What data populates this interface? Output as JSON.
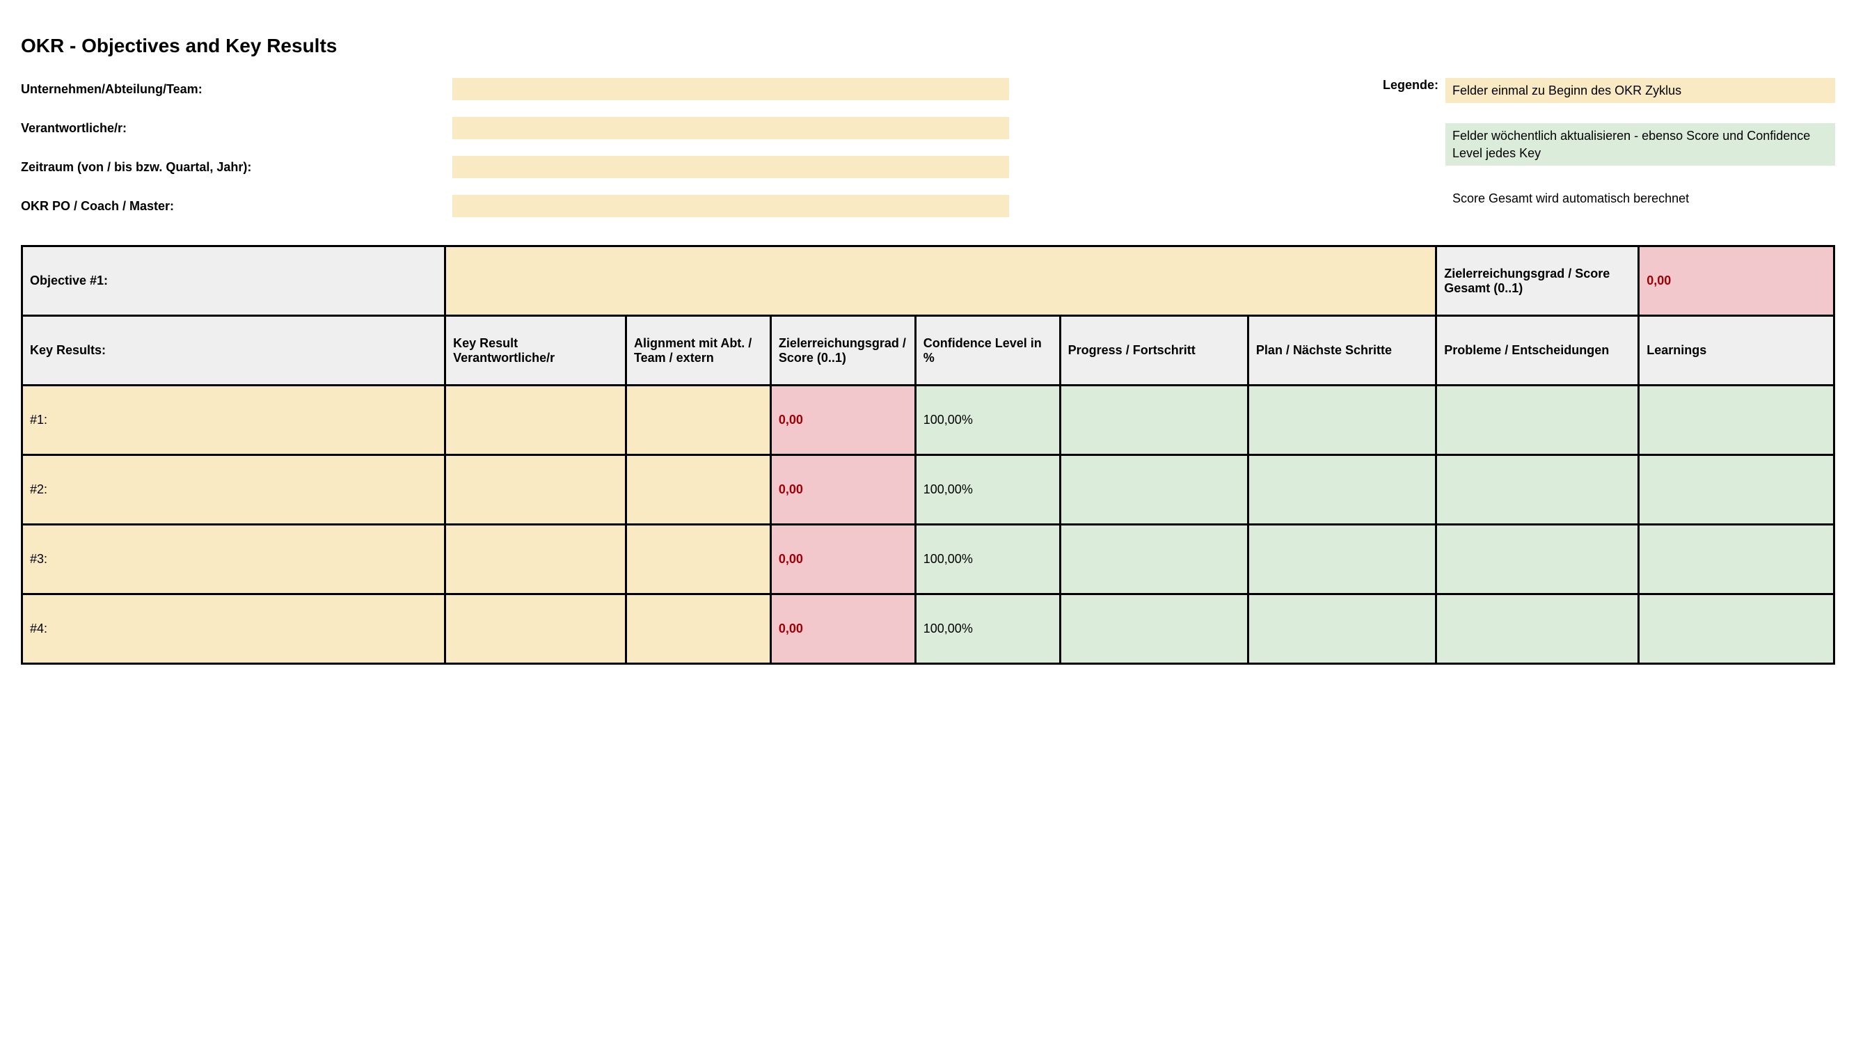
{
  "title": "OKR - Objectives and Key Results",
  "meta": {
    "company_label": "Unternehmen/Abteilung/Team:",
    "responsible_label": "Verantwortliche/r:",
    "period_label": "Zeitraum (von / bis bzw. Quartal, Jahr):",
    "coach_label": "OKR PO / Coach / Master:",
    "company_value": "",
    "responsible_value": "",
    "period_value": "",
    "coach_value": ""
  },
  "legend": {
    "label": "Legende:",
    "item_yellow": "Felder einmal zu Beginn des OKR Zyklus",
    "item_green": "Felder wöchentlich aktualisieren - ebenso Score und Confidence Level jedes Key",
    "item_plain": "Score Gesamt wird automatisch berechnet"
  },
  "table": {
    "objective_label": "Objective #1:",
    "objective_value": "",
    "score_total_label": "Zielerreichungsgrad / Score Gesamt (0..1)",
    "score_total_value": "0,00",
    "headers": {
      "key_results": "Key Results:",
      "kr_owner": "Key Result Verantwortliche/r",
      "alignment": "Alignment mit Abt. / Team / extern",
      "score": "Zielerreichungsgrad / Score (0..1)",
      "confidence": "Confidence Level in %",
      "progress": "Progress / Fortschritt",
      "plan": "Plan / Nächste Schritte",
      "problems": "Probleme / Entscheidungen",
      "learnings": "Learnings"
    },
    "rows": [
      {
        "label": "#1:",
        "kr_owner": "",
        "alignment": "",
        "score": "0,00",
        "confidence": "100,00%",
        "progress": "",
        "plan": "",
        "problems": "",
        "learnings": ""
      },
      {
        "label": "#2:",
        "kr_owner": "",
        "alignment": "",
        "score": "0,00",
        "confidence": "100,00%",
        "progress": "",
        "plan": "",
        "problems": "",
        "learnings": ""
      },
      {
        "label": "#3:",
        "kr_owner": "",
        "alignment": "",
        "score": "0,00",
        "confidence": "100,00%",
        "progress": "",
        "plan": "",
        "problems": "",
        "learnings": ""
      },
      {
        "label": "#4:",
        "kr_owner": "",
        "alignment": "",
        "score": "0,00",
        "confidence": "100,00%",
        "progress": "",
        "plan": "",
        "problems": "",
        "learnings": ""
      }
    ]
  }
}
